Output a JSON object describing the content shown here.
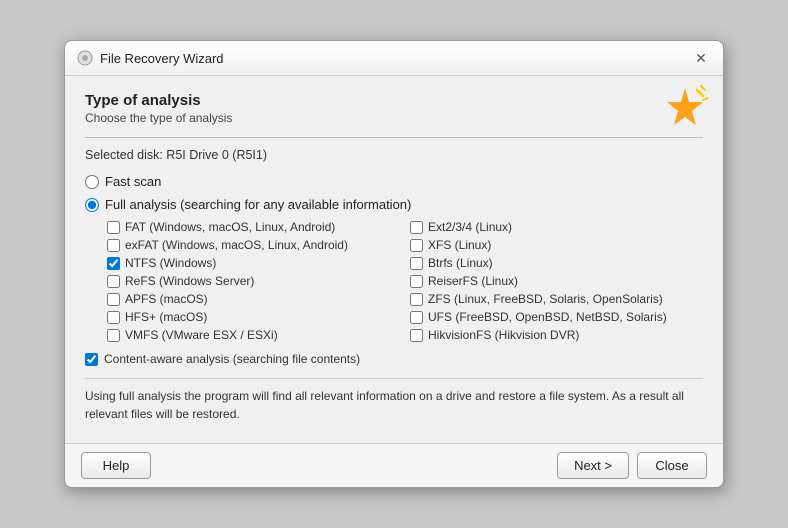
{
  "dialog": {
    "title": "File Recovery Wizard",
    "close_label": "✕"
  },
  "header": {
    "type_of_analysis": "Type of analysis",
    "subtitle": "Choose the type of analysis"
  },
  "selected_disk_label": "Selected disk: R5I Drive 0 (R5I1)",
  "radio_options": [
    {
      "id": "fast-scan",
      "label": "Fast scan",
      "checked": false
    },
    {
      "id": "full-analysis",
      "label": "Full analysis (searching for any available information)",
      "checked": true
    }
  ],
  "checkboxes_left": [
    {
      "id": "fat",
      "label": "FAT (Windows, macOS, Linux, Android)",
      "checked": false
    },
    {
      "id": "exfat",
      "label": "exFAT (Windows, macOS, Linux, Android)",
      "checked": false
    },
    {
      "id": "ntfs",
      "label": "NTFS (Windows)",
      "checked": true
    },
    {
      "id": "refs",
      "label": "ReFS (Windows Server)",
      "checked": false
    },
    {
      "id": "apfs",
      "label": "APFS (macOS)",
      "checked": false
    },
    {
      "id": "hfsplus",
      "label": "HFS+ (macOS)",
      "checked": false
    },
    {
      "id": "vmfs",
      "label": "VMFS (VMware ESX / ESXi)",
      "checked": false
    }
  ],
  "checkboxes_right": [
    {
      "id": "ext234",
      "label": "Ext2/3/4 (Linux)",
      "checked": false
    },
    {
      "id": "xfs",
      "label": "XFS (Linux)",
      "checked": false
    },
    {
      "id": "btrfs",
      "label": "Btrfs (Linux)",
      "checked": false
    },
    {
      "id": "reiserfs",
      "label": "ReiserFS (Linux)",
      "checked": false
    },
    {
      "id": "zfs",
      "label": "ZFS (Linux, FreeBSD, Solaris, OpenSolaris)",
      "checked": false
    },
    {
      "id": "ufs",
      "label": "UFS (FreeBSD, OpenBSD, NetBSD, Solaris)",
      "checked": false
    },
    {
      "id": "hikvision",
      "label": "HikvisionFS (Hikvision DVR)",
      "checked": false
    }
  ],
  "content_aware": {
    "label": "Content-aware analysis (searching file contents)",
    "checked": true
  },
  "info_text": "Using full analysis the program will find all relevant information on a drive and restore a file system. As a result all relevant files will be restored.",
  "footer": {
    "help_label": "Help",
    "next_label": "Next >",
    "close_label": "Close"
  }
}
